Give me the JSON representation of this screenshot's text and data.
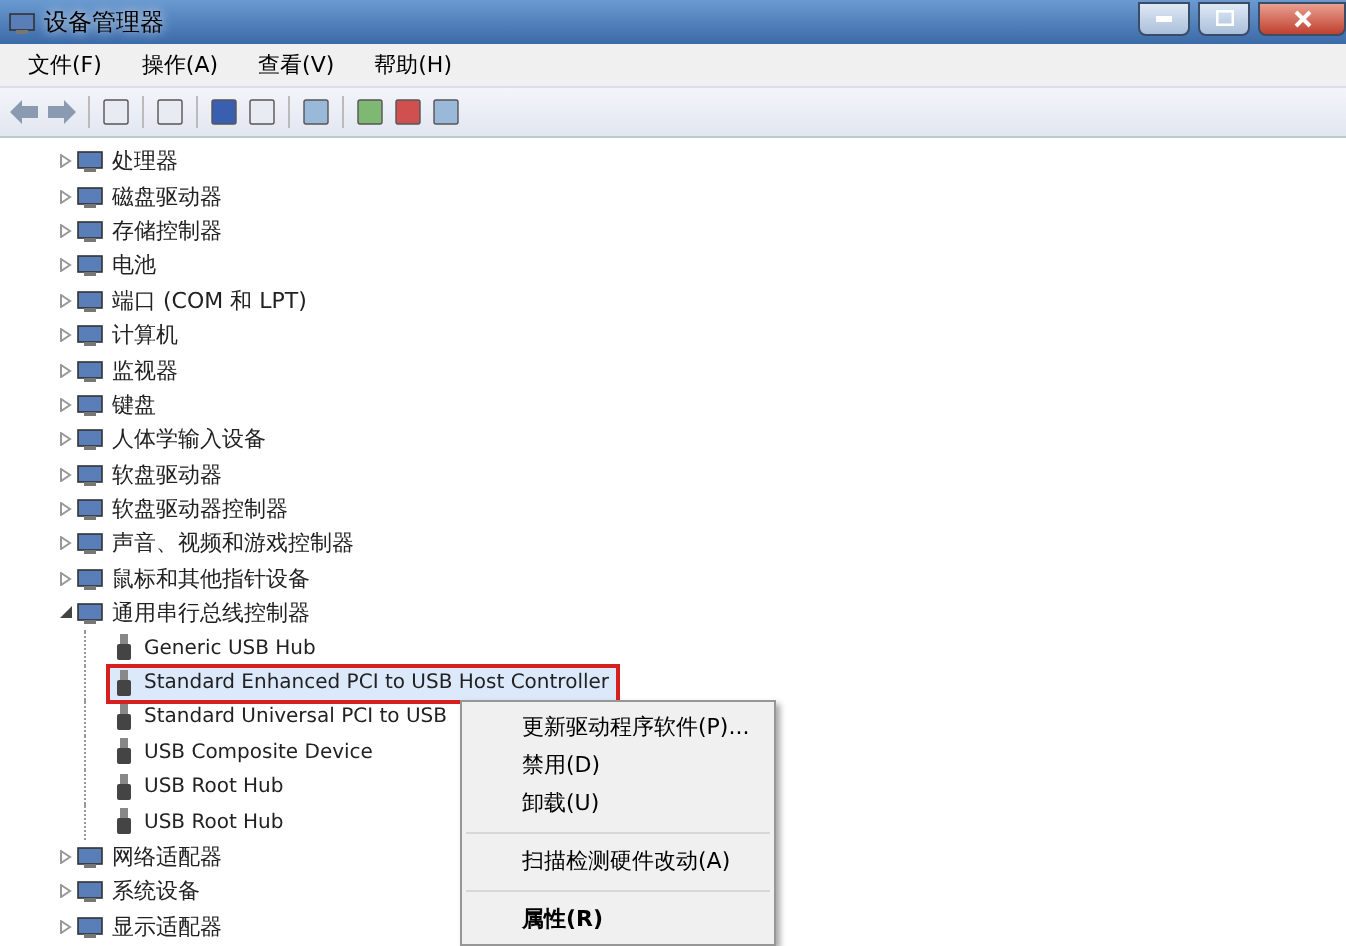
{
  "window": {
    "title": "设备管理器"
  },
  "menu_bar": [
    "文件(F)",
    "操作(A)",
    "查看(V)",
    "帮助(H)"
  ],
  "tree": [
    {
      "label": "处理器",
      "expanded": false
    },
    {
      "label": "磁盘驱动器",
      "expanded": false
    },
    {
      "label": "存储控制器",
      "expanded": false
    },
    {
      "label": "电池",
      "expanded": false
    },
    {
      "label": "端口 (COM 和 LPT)",
      "expanded": false
    },
    {
      "label": "计算机",
      "expanded": false
    },
    {
      "label": "监视器",
      "expanded": false
    },
    {
      "label": "键盘",
      "expanded": false
    },
    {
      "label": "人体学输入设备",
      "expanded": false
    },
    {
      "label": "软盘驱动器",
      "expanded": false
    },
    {
      "label": "软盘驱动器控制器",
      "expanded": false
    },
    {
      "label": "声音、视频和游戏控制器",
      "expanded": false
    },
    {
      "label": "鼠标和其他指针设备",
      "expanded": false
    },
    {
      "label": "通用串行总线控制器",
      "expanded": true,
      "children": [
        {
          "label": "Generic USB Hub",
          "selected": false
        },
        {
          "label": "Standard Enhanced PCI to USB Host Controller",
          "selected": true
        },
        {
          "label": "Standard Universal PCI to USB",
          "selected": false
        },
        {
          "label": "USB Composite Device",
          "selected": false
        },
        {
          "label": "USB Root Hub",
          "selected": false
        },
        {
          "label": "USB Root Hub",
          "selected": false
        }
      ]
    },
    {
      "label": "网络适配器",
      "expanded": false
    },
    {
      "label": "系统设备",
      "expanded": false
    },
    {
      "label": "显示适配器",
      "expanded": false
    }
  ],
  "context_menu": [
    {
      "label": "更新驱动程序软件(P)...",
      "separator_before": false,
      "default": false
    },
    {
      "label": "禁用(D)",
      "separator_before": false,
      "default": false
    },
    {
      "label": "卸载(U)",
      "separator_before": false,
      "default": false
    },
    {
      "label": "扫描检测硬件改动(A)",
      "separator_before": true,
      "default": false
    },
    {
      "label": "属性(R)",
      "separator_before": true,
      "default": true
    }
  ]
}
